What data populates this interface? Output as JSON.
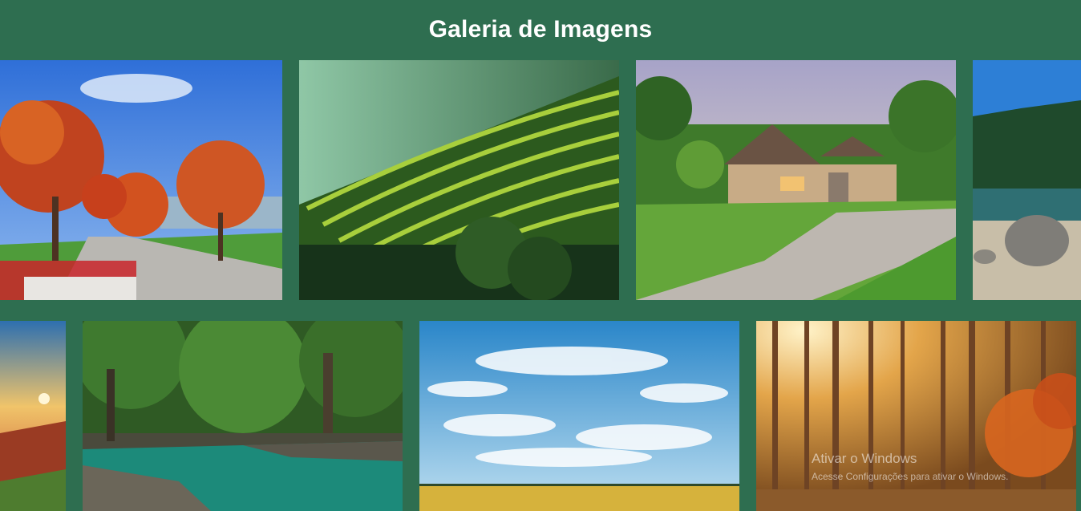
{
  "page": {
    "title": "Galeria de Imagens"
  },
  "gallery": {
    "images": [
      {
        "subject": "autumn trees in park",
        "icon": "autumn-park-image"
      },
      {
        "subject": "rice terraces in mist",
        "icon": "rice-terraces-image"
      },
      {
        "subject": "stone house with driveway",
        "icon": "house-image"
      },
      {
        "subject": "mountain lake with rock",
        "icon": "lake-image"
      },
      {
        "subject": "sunset over hills",
        "icon": "sunset-hills-image"
      },
      {
        "subject": "river in forest",
        "icon": "forest-river-image"
      },
      {
        "subject": "blue sky over wheat field",
        "icon": "sky-field-image"
      },
      {
        "subject": "sunlit autumn pine forest",
        "icon": "autumn-forest-image"
      }
    ]
  },
  "watermark": {
    "line1": "Ativar o Windows",
    "line2": "Acesse Configurações para ativar o Windows."
  },
  "colors": {
    "header_bg": "#2e6e50",
    "title_text": "#ffffff"
  }
}
